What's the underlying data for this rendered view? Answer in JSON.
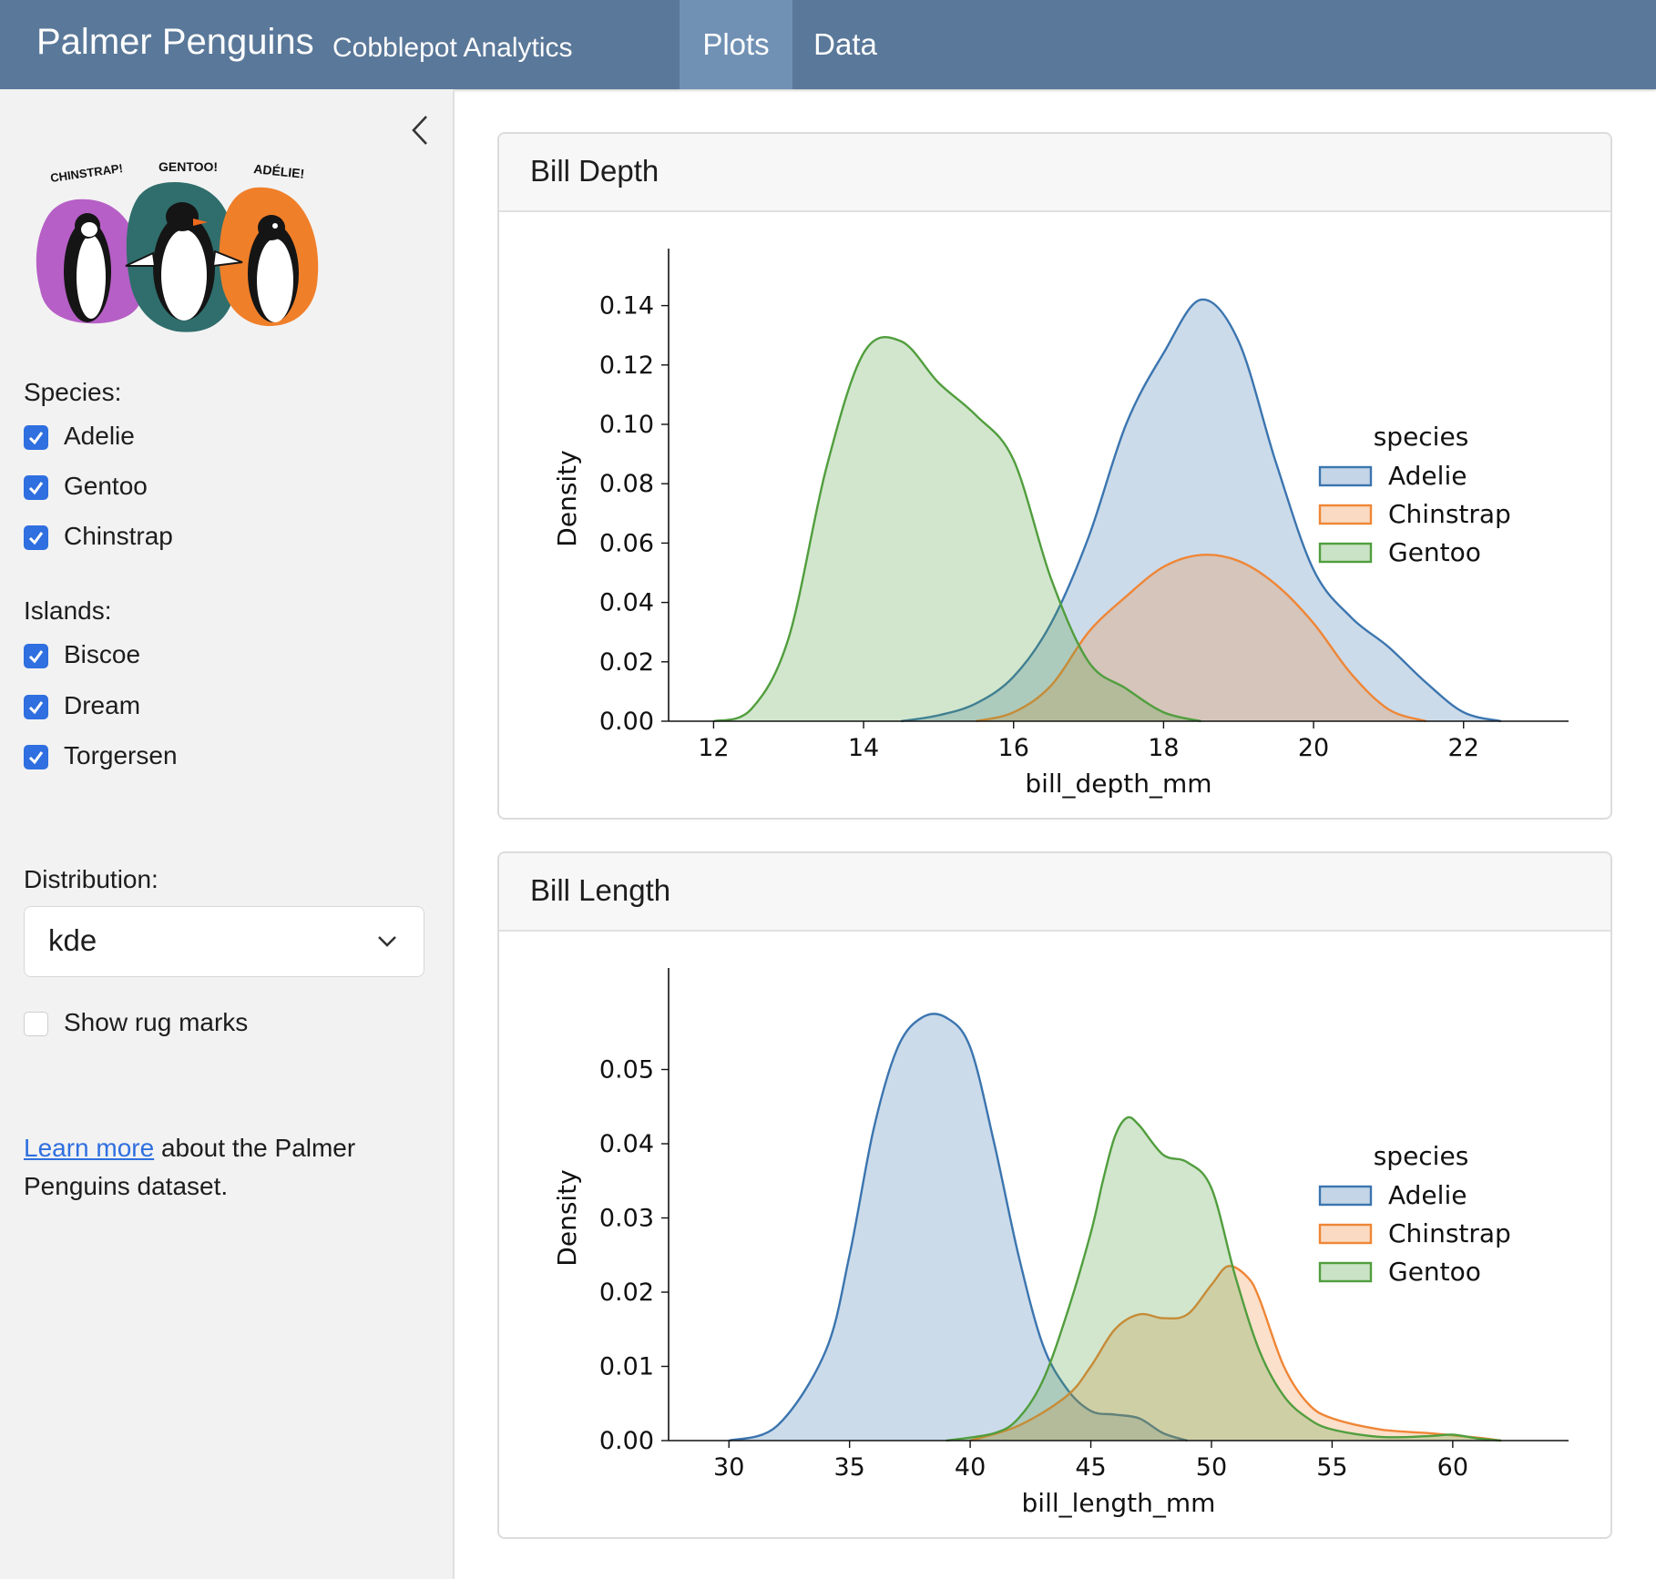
{
  "navbar": {
    "title": "Palmer Penguins",
    "subtitle": "Cobblepot Analytics",
    "tabs": [
      {
        "label": "Plots",
        "active": true
      },
      {
        "label": "Data",
        "active": false
      }
    ]
  },
  "sidebar": {
    "logo_labels": [
      "CHINSTRAP!",
      "GENTOO!",
      "ADÉLIE!"
    ],
    "species_label": "Species:",
    "species": [
      {
        "label": "Adelie",
        "checked": true
      },
      {
        "label": "Gentoo",
        "checked": true
      },
      {
        "label": "Chinstrap",
        "checked": true
      }
    ],
    "islands_label": "Islands:",
    "islands": [
      {
        "label": "Biscoe",
        "checked": true
      },
      {
        "label": "Dream",
        "checked": true
      },
      {
        "label": "Torgersen",
        "checked": true
      }
    ],
    "distribution_label": "Distribution:",
    "distribution_value": "kde",
    "rug_label": "Show rug marks",
    "rug_checked": false,
    "learn_link": "Learn more",
    "learn_text": " about the Palmer Penguins dataset."
  },
  "colors": {
    "accent": "#2f6fe0",
    "navbar": "#5a7899",
    "adelie": "#3b75af",
    "chinstrap": "#ef8636",
    "gentoo": "#519e3e"
  },
  "cards": [
    {
      "title": "Bill Depth"
    },
    {
      "title": "Bill Length"
    }
  ],
  "chart_data": [
    {
      "type": "area",
      "xlabel": "bill_depth_mm",
      "ylabel": "Density",
      "xlim": [
        11.4,
        23.4
      ],
      "ylim": [
        0,
        0.15
      ],
      "xticks": [
        "12",
        "14",
        "16",
        "18",
        "20",
        "22"
      ],
      "xtick_values": [
        12,
        14,
        16,
        18,
        20,
        22
      ],
      "yticks": [
        "0.00",
        "0.02",
        "0.04",
        "0.06",
        "0.08",
        "0.10",
        "0.12",
        "0.14"
      ],
      "ytick_values": [
        0,
        0.02,
        0.04,
        0.06,
        0.08,
        0.1,
        0.12,
        0.14
      ],
      "legend_title": "species",
      "legend_position": "right",
      "series": [
        {
          "name": "Adelie",
          "color": "#3b75af",
          "x": [
            14.5,
            15.0,
            15.5,
            16.0,
            16.5,
            17.0,
            17.5,
            18.0,
            18.5,
            19.0,
            19.5,
            20.0,
            20.5,
            21.0,
            21.5,
            22.0,
            22.5
          ],
          "y": [
            0.0,
            0.002,
            0.006,
            0.015,
            0.033,
            0.062,
            0.1,
            0.124,
            0.142,
            0.128,
            0.087,
            0.051,
            0.035,
            0.025,
            0.013,
            0.003,
            0.0
          ]
        },
        {
          "name": "Chinstrap",
          "color": "#ef8636",
          "x": [
            15.5,
            16.0,
            16.5,
            17.0,
            17.5,
            18.0,
            18.5,
            19.0,
            19.5,
            20.0,
            20.5,
            21.0,
            21.5
          ],
          "y": [
            0.0,
            0.003,
            0.012,
            0.03,
            0.042,
            0.052,
            0.056,
            0.054,
            0.046,
            0.033,
            0.016,
            0.004,
            0.0
          ]
        },
        {
          "name": "Gentoo",
          "color": "#519e3e",
          "x": [
            12.0,
            12.5,
            13.0,
            13.5,
            14.0,
            14.5,
            15.0,
            15.5,
            16.0,
            16.5,
            17.0,
            17.5,
            18.0,
            18.5
          ],
          "y": [
            0.0,
            0.004,
            0.028,
            0.085,
            0.124,
            0.128,
            0.114,
            0.103,
            0.088,
            0.048,
            0.02,
            0.011,
            0.003,
            0.0
          ]
        }
      ]
    },
    {
      "type": "area",
      "xlabel": "bill_length_mm",
      "ylabel": "Density",
      "xlim": [
        27.5,
        64.8
      ],
      "ylim": [
        0,
        0.06
      ],
      "xticks": [
        "30",
        "35",
        "40",
        "45",
        "50",
        "55",
        "60"
      ],
      "xtick_values": [
        30,
        35,
        40,
        45,
        50,
        55,
        60
      ],
      "yticks": [
        "0.00",
        "0.01",
        "0.02",
        "0.03",
        "0.04",
        "0.05"
      ],
      "ytick_values": [
        0,
        0.01,
        0.02,
        0.03,
        0.04,
        0.05
      ],
      "legend_title": "species",
      "legend_position": "right",
      "series": [
        {
          "name": "Adelie",
          "color": "#3b75af",
          "x": [
            30,
            32,
            34,
            35,
            36,
            37,
            38,
            39,
            40,
            41,
            42,
            43,
            44,
            45,
            46,
            47,
            48,
            49
          ],
          "y": [
            0.0,
            0.002,
            0.012,
            0.025,
            0.042,
            0.053,
            0.057,
            0.057,
            0.053,
            0.04,
            0.025,
            0.013,
            0.007,
            0.004,
            0.0035,
            0.003,
            0.001,
            0.0
          ]
        },
        {
          "name": "Chinstrap",
          "color": "#ef8636",
          "x": [
            40,
            42,
            44,
            45,
            46,
            47,
            48,
            49,
            50,
            50.7,
            51.5,
            52,
            53,
            54,
            55,
            57,
            59,
            61,
            62
          ],
          "y": [
            0.0,
            0.002,
            0.006,
            0.01,
            0.015,
            0.017,
            0.0165,
            0.017,
            0.021,
            0.0235,
            0.022,
            0.019,
            0.01,
            0.005,
            0.003,
            0.0015,
            0.001,
            0.0004,
            0.0
          ]
        },
        {
          "name": "Gentoo",
          "color": "#519e3e",
          "x": [
            39,
            41,
            42,
            43,
            44,
            45,
            45.5,
            46,
            46.5,
            47,
            48,
            49,
            50,
            51,
            52,
            53,
            54,
            55,
            57,
            59,
            60,
            61,
            62
          ],
          "y": [
            0.0,
            0.001,
            0.003,
            0.008,
            0.017,
            0.028,
            0.035,
            0.041,
            0.0435,
            0.0425,
            0.0385,
            0.0375,
            0.034,
            0.022,
            0.012,
            0.006,
            0.003,
            0.0015,
            0.0005,
            0.0006,
            0.0008,
            0.0003,
            0.0
          ]
        }
      ]
    }
  ]
}
